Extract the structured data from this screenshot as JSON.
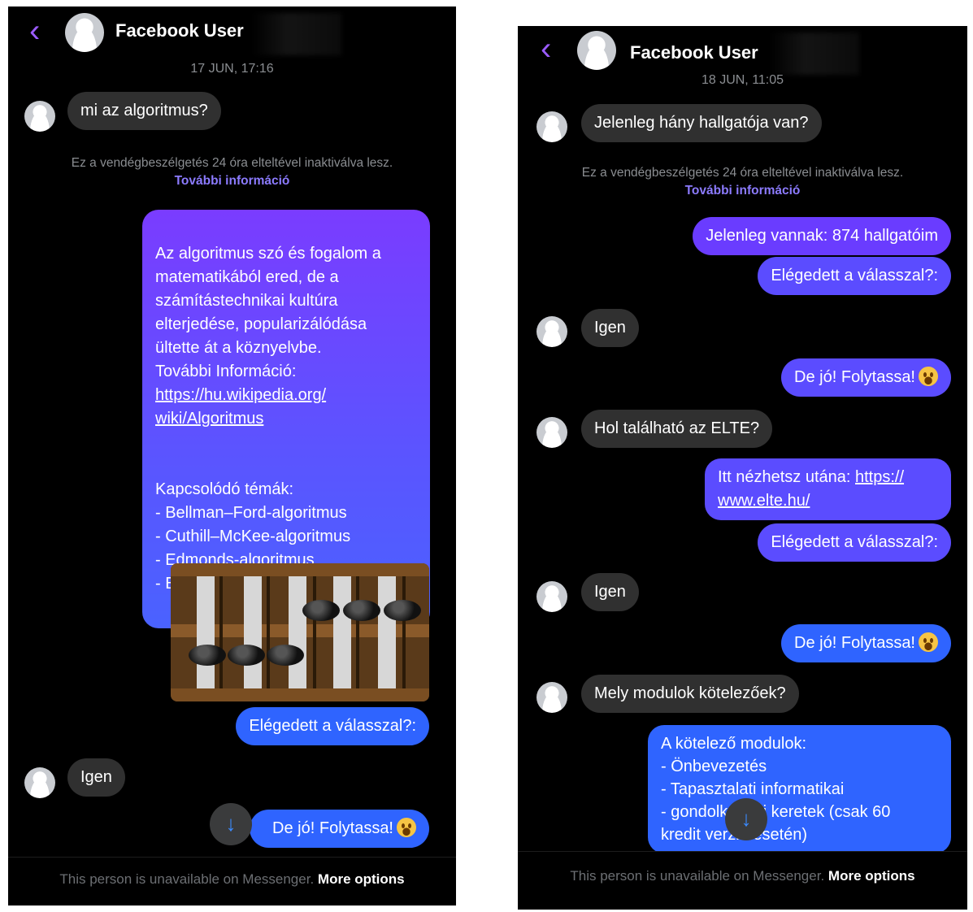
{
  "left": {
    "header": {
      "name": "Facebook User"
    },
    "timestamp": "17 JUN, 17:16",
    "notice": {
      "text": "Ez a vendégbeszélgetés 24 óra elteltével inaktiválva lesz.",
      "link": "További információ"
    },
    "messages": [
      {
        "from": "user",
        "text": "mi az algoritmus?"
      },
      {
        "from": "bot",
        "text_pre": "Az algoritmus szó és fogalom a\nmatematikából ered, de a\nszámítástechnikai kultúra\nelterjedése, popularizálódása\nültette át a köznyelvbe.\nTovábbi Információ:",
        "link": "https://hu.wikipedia.org/\nwiki/Algoritmus",
        "text_post": "Kapcsolódó témák:\n- Bellman–Ford-algoritmus\n- Cuthill–McKee-algoritmus\n- Edmonds-algoritmus\n- Euklideszi algoritmus"
      },
      {
        "from": "bot",
        "text": "Elégedett a válasszal?:"
      },
      {
        "from": "user",
        "text": "Igen"
      },
      {
        "from": "bot",
        "text": "De jó! Folytassa!"
      }
    ],
    "footer": {
      "text": "This person is unavailable on Messenger.",
      "more": "More options"
    }
  },
  "right": {
    "header": {
      "name": "Facebook User"
    },
    "timestamp": "18 JUN, 11:05",
    "notice": {
      "text": "Ez a vendégbeszélgetés 24 óra elteltével inaktiválva lesz.",
      "link": "További információ"
    },
    "messages": [
      {
        "from": "user",
        "text": "Jelenleg hány hallgatója van?"
      },
      {
        "from": "bot",
        "text": "Jelenleg vannak: 874 hallgatóim"
      },
      {
        "from": "bot",
        "text": "Elégedett a válasszal?:"
      },
      {
        "from": "user",
        "text": "Igen"
      },
      {
        "from": "bot",
        "text": "De jó! Folytassa!"
      },
      {
        "from": "user",
        "text": "Hol található az ELTE?"
      },
      {
        "from": "bot",
        "text_pre": "Itt nézhetsz utána: ",
        "link": "https://\nwww.elte.hu/"
      },
      {
        "from": "bot",
        "text": "Elégedett a válasszal?:"
      },
      {
        "from": "user",
        "text": "Igen"
      },
      {
        "from": "bot",
        "text": "De jó! Folytassa!"
      },
      {
        "from": "user",
        "text": "Mely modulok kötelezőek?"
      },
      {
        "from": "bot",
        "text": "A kötelező modulok:\n- Önbevezetés\n- Tapasztalati informatikai\n- gondolkodási keretek (csak 60\nkredit verzió esetén)"
      }
    ],
    "footer": {
      "text": "This person is unavailable on Messenger.",
      "more": "More options"
    }
  },
  "icons": {
    "back": "chevron-left-icon",
    "scroll_down": "arrow-down-icon",
    "emoji": "grinning-face-emoji"
  },
  "colors": {
    "accent": "#9b5cff",
    "link": "#8c7bff",
    "incoming": "#303030",
    "outgoing": "#2f64ff"
  }
}
